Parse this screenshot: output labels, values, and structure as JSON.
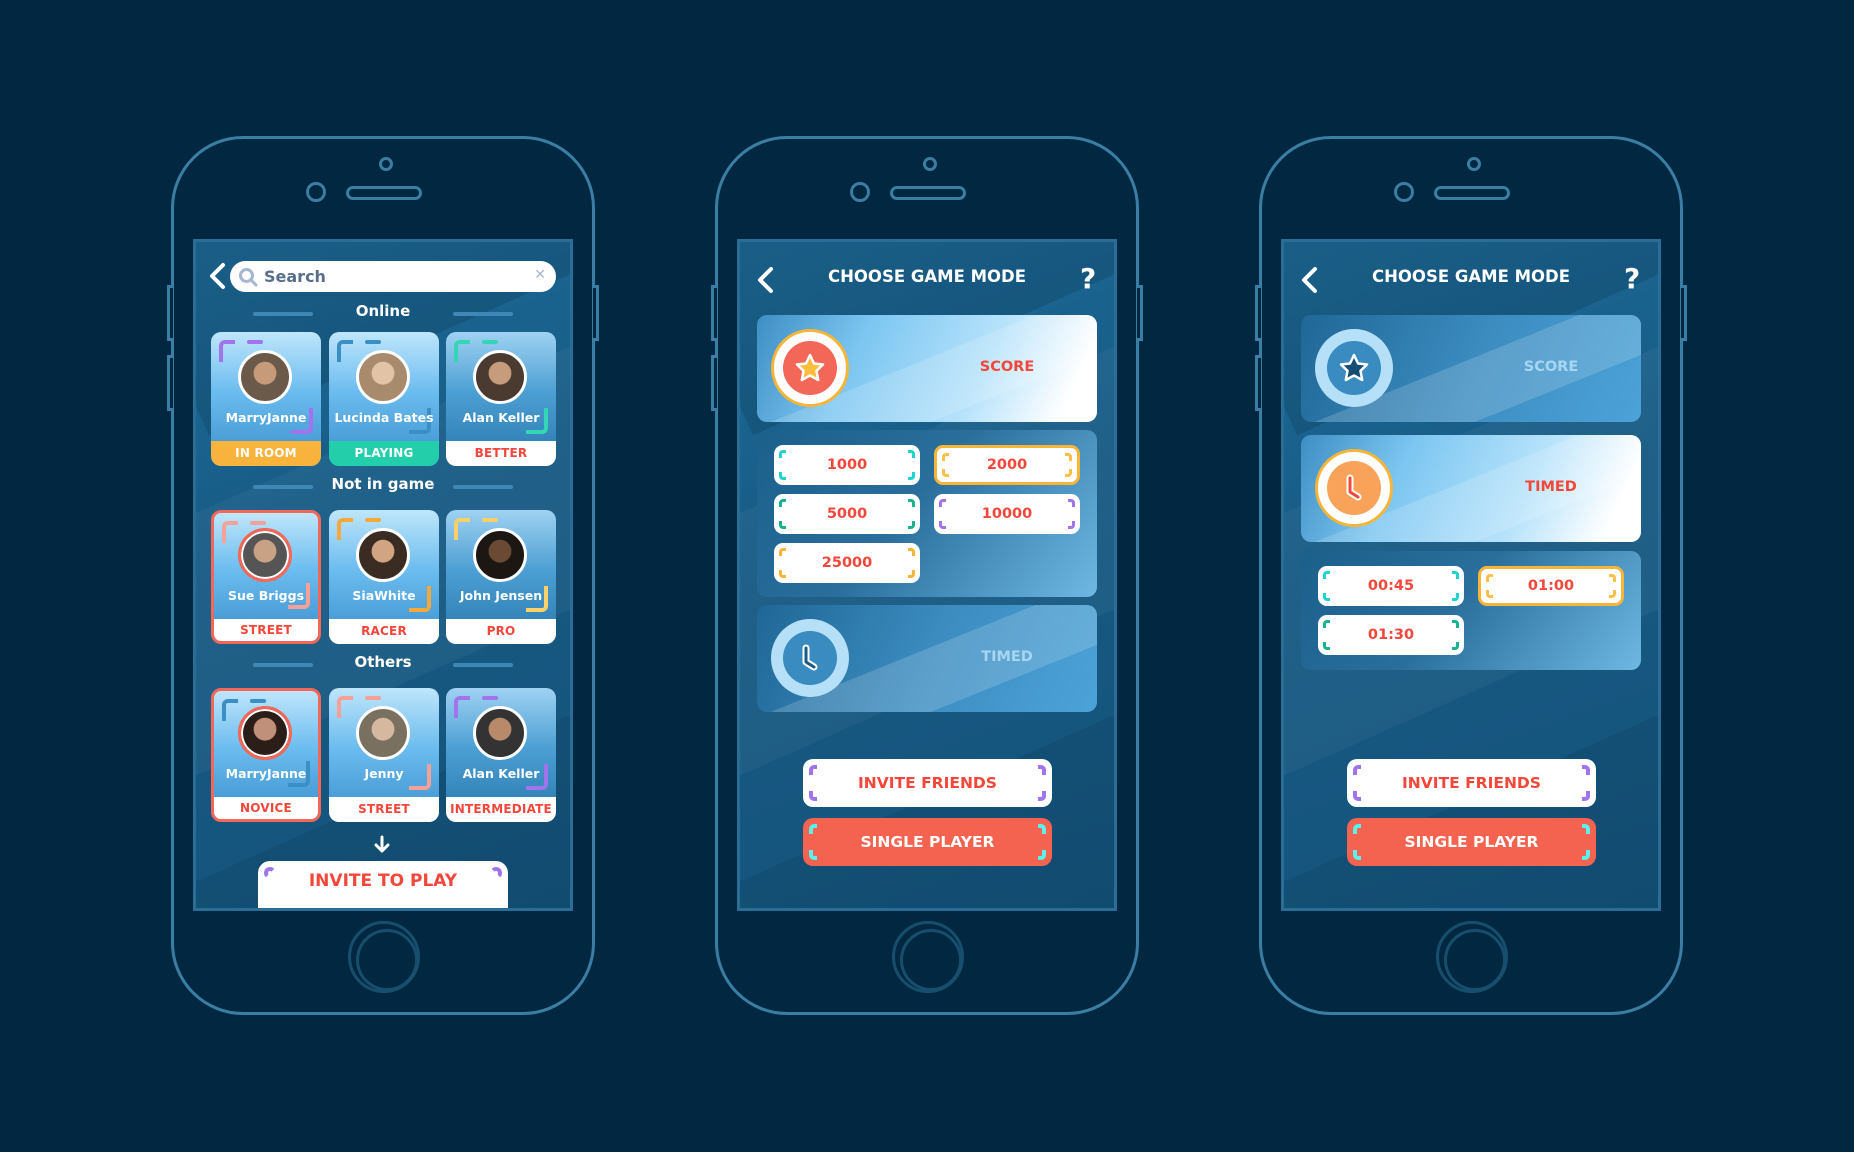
{
  "colors": {
    "background": "#022740",
    "accent_red": "#f2473a",
    "button_red": "#f4634f",
    "selected_yellow": "#f7b538",
    "purple": "#a173ec",
    "teal": "#1fd3d0",
    "green": "#17b48f",
    "orange": "#f7a83b"
  },
  "screen1": {
    "search": {
      "placeholder": "Search",
      "value": ""
    },
    "sections": [
      {
        "title": "Online",
        "players": [
          {
            "name": "MarryJanne",
            "status": "IN ROOM",
            "status_color": "#f8b33d",
            "status_text_color": "#ffffff",
            "accent": "#a173ec"
          },
          {
            "name": "Lucinda Bates",
            "status": "PLAYING",
            "status_color": "#22cfaa",
            "status_text_color": "#ffffff",
            "accent": "#3a8fc4"
          },
          {
            "name": "Alan Keller",
            "status": "BETTER",
            "status_color": "#ffffff",
            "status_text_color": "#f2473a",
            "accent": "#34d6b6"
          }
        ]
      },
      {
        "title": "Not in game",
        "players": [
          {
            "name": "Sue Briggs",
            "status": "STREET",
            "status_color": "#ffffff",
            "status_text_color": "#f2473a",
            "accent": "#f7a097",
            "selected": true
          },
          {
            "name": "SiaWhite",
            "status": "RACER",
            "status_color": "#ffffff",
            "status_text_color": "#f2473a",
            "accent": "#f7a83b"
          },
          {
            "name": "John Jensen",
            "status": "PRO",
            "status_color": "#ffffff",
            "status_text_color": "#f2473a",
            "accent": "#fbcf6a"
          }
        ]
      },
      {
        "title": "Others",
        "players": [
          {
            "name": "MarryJanne",
            "status": "NOVICE",
            "status_color": "#ffffff",
            "status_text_color": "#f2473a",
            "accent": "#3a8fc4",
            "selected": true
          },
          {
            "name": "Jenny",
            "status": "STREET",
            "status_color": "#ffffff",
            "status_text_color": "#f2473a",
            "accent": "#f7a097"
          },
          {
            "name": "Alan Keller",
            "status": "INTERMEDIATE",
            "status_color": "#ffffff",
            "status_text_color": "#f2473a",
            "accent": "#a173ec"
          }
        ]
      }
    ],
    "invite_button": "INVITE TO PLAY"
  },
  "screen2": {
    "title": "CHOOSE GAME MODE",
    "help": "?",
    "modes": [
      {
        "label": "SCORE",
        "icon": "star-icon",
        "active": true
      },
      {
        "label": "TIMED",
        "icon": "clock-icon",
        "active": false
      }
    ],
    "options": [
      {
        "value": "1000",
        "accent": "#1fd3d0",
        "selected": false
      },
      {
        "value": "2000",
        "accent": "#fbc04a",
        "selected": true
      },
      {
        "value": "5000",
        "accent": "#17b48f",
        "selected": false
      },
      {
        "value": "10000",
        "accent": "#a173ec",
        "selected": false
      },
      {
        "value": "25000",
        "accent": "#f7b538",
        "selected": false
      }
    ],
    "invite_friends": "INVITE FRIENDS",
    "single_player": "SINGLE PLAYER"
  },
  "screen3": {
    "title": "CHOOSE GAME MODE",
    "help": "?",
    "modes": [
      {
        "label": "SCORE",
        "icon": "star-icon",
        "active": false
      },
      {
        "label": "TIMED",
        "icon": "clock-icon",
        "active": true
      }
    ],
    "options": [
      {
        "value": "00:45",
        "accent": "#1fd3d0",
        "selected": false
      },
      {
        "value": "01:00",
        "accent": "#fbc04a",
        "selected": true
      },
      {
        "value": "01:30",
        "accent": "#17b48f",
        "selected": false
      }
    ],
    "invite_friends": "INVITE FRIENDS",
    "single_player": "SINGLE PLAYER"
  }
}
